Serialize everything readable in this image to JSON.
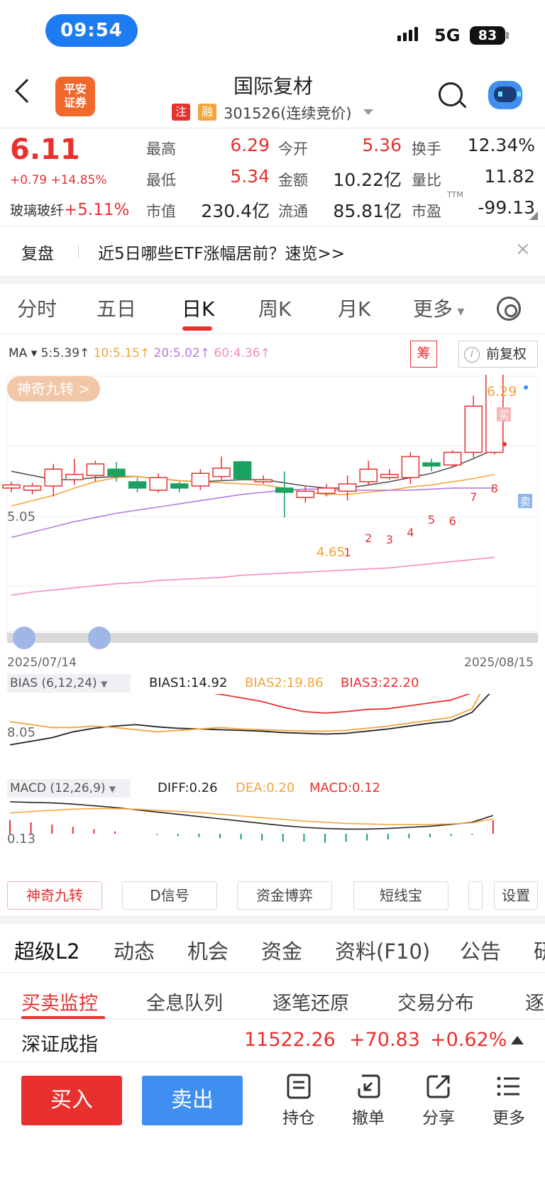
{
  "status_bar": {
    "time": "09:54",
    "network": "5G",
    "battery": "83"
  },
  "header": {
    "logo_text": "平安\n证券",
    "stock_name": "国际复材",
    "tag_zhu": "注",
    "tag_rong": "融",
    "code_status": "301526(连续竞价)"
  },
  "quote": {
    "price": "6.11",
    "change": "+0.79 +14.85%",
    "sector_name": "玻璃玻纤",
    "sector_change": "+5.11%",
    "rows": [
      [
        {
          "label": "最高",
          "value": "6.29",
          "color": "#e8302f"
        },
        {
          "label": "今开",
          "value": "5.36",
          "color": "#e8302f"
        },
        {
          "label": "换手",
          "value": "12.34%",
          "color": "#222222"
        }
      ],
      [
        {
          "label": "最低",
          "value": "5.34",
          "color": "#e8302f"
        },
        {
          "label": "金额",
          "value": "10.22亿",
          "color": "#222222"
        },
        {
          "label": "量比",
          "value": "11.82",
          "color": "#222222"
        }
      ],
      [
        {
          "label": "市值",
          "value": "230.4亿",
          "color": "#222222"
        },
        {
          "label": "流通",
          "value": "85.81亿",
          "color": "#222222"
        },
        {
          "label": "市盈",
          "value": "-99.13",
          "color": "#222222"
        }
      ]
    ],
    "ttm": "TTM"
  },
  "banner": {
    "replay": "复盘",
    "text": "近5日哪些ETF涨幅居前？速览>>",
    "close": "×"
  },
  "chart_tabs": [
    "分时",
    "五日",
    "日K",
    "周K",
    "月K",
    "更多"
  ],
  "chart_tabs_active": 2,
  "ma": {
    "label": "MA",
    "items": [
      {
        "text": "5:5.39",
        "color": "#444444"
      },
      {
        "text": "10:5.15",
        "color": "#f3a43a"
      },
      {
        "text": "20:5.02",
        "color": "#b57be0"
      },
      {
        "text": "60:4.36",
        "color": "#f28cc0"
      }
    ],
    "chou": "筹",
    "fq": "前复权",
    "fq_i": "i"
  },
  "kline": {
    "badge": "神奇九转 >",
    "left_label_mid": "5.05",
    "low_label": "4.65",
    "high_label": "6.29",
    "buy_tag": "买",
    "sell_tag": "卖",
    "seq_labels": [
      "1",
      "2",
      "3",
      "4",
      "5",
      "6",
      "7",
      "8"
    ],
    "date_start": "2025/07/14",
    "date_end": "2025/08/15"
  },
  "bias": {
    "box": "BIAS (6,12,24)",
    "b1": "BIAS1:14.92",
    "b2": "BIAS2:19.86",
    "b3": "BIAS3:22.20",
    "left_label": "8.05"
  },
  "macd": {
    "box": "MACD (12,26,9)",
    "diff": "DIFF:0.26",
    "dea": "DEA:0.20",
    "macd": "MACD:0.12",
    "left_label": "0.13"
  },
  "tools": [
    "神奇九转",
    "D信号",
    "资金博弈",
    "短线宝",
    "",
    "设置"
  ],
  "bottom_tabs": [
    "超级L2",
    "动态",
    "机会",
    "资金",
    "资料(F10)",
    "公告",
    "研"
  ],
  "sub_tabs": [
    "买卖监控",
    "全息队列",
    "逐笔还原",
    "交易分布",
    "逐"
  ],
  "index": {
    "name": "深证成指",
    "value": "11522.26",
    "change": "+70.83",
    "pct": "+0.62%"
  },
  "actions": {
    "buy": "买入",
    "sell": "卖出",
    "hold": "持仓",
    "cancel": "撤单",
    "share": "分享",
    "more": "更多"
  }
}
